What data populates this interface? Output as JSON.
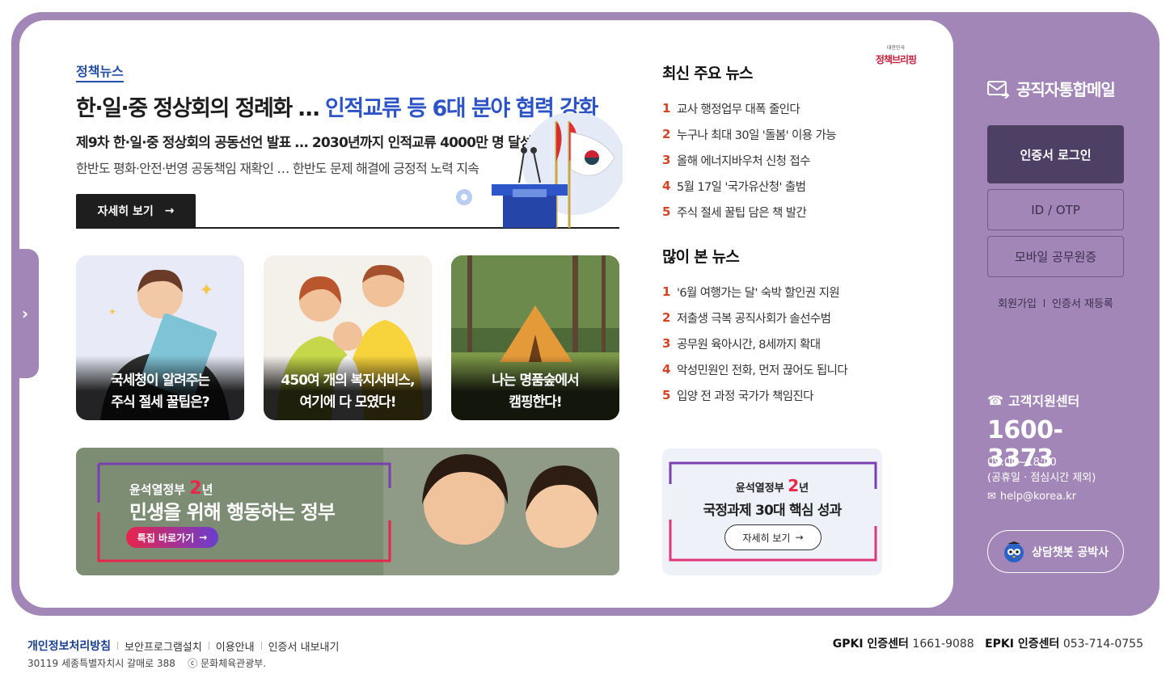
{
  "hero": {
    "tag": "정책뉴스",
    "title_main": "한·일·중 정상회의 정례화 … ",
    "title_highlight": "인적교류 등 6대 분야 협력 강화",
    "subtitle1": "제9차 한·일·중 정상회의 공동선언 발표 … 2030년까지 인적교류 4000만 명 달성",
    "subtitle2": "한반도 평화·안전·번영 공동책임 재확인 … 한반도 문제 해결에 긍정적 노력 지속",
    "more_label": "자세히 보기",
    "more_icon": "→"
  },
  "brand": {
    "small": "대한민국",
    "big": "정책브리핑"
  },
  "cards": [
    {
      "line1": "국세청이 알려주는",
      "line2": "주식 절세 꿀팁은?"
    },
    {
      "line1": "450여 개의 복지서비스,",
      "line2": "여기에 다 모였다!"
    },
    {
      "line1": "나는 명품숲에서",
      "line2": "캠핑한다!"
    }
  ],
  "banner": {
    "line1_prefix": "윤석열정부",
    "line1_num": "2",
    "line1_suffix": "년",
    "line2": "민생을 위해 행동하는 정부",
    "btn_label": "특집 바로가기",
    "btn_icon": "→"
  },
  "latest_news": {
    "heading": "최신 주요 뉴스",
    "items": [
      {
        "num": "1",
        "text": "교사 행정업무 대폭 줄인다"
      },
      {
        "num": "2",
        "text": "누구나 최대 30일 '돌봄' 이용 가능"
      },
      {
        "num": "3",
        "text": "올해 에너지바우처 신청 접수"
      },
      {
        "num": "4",
        "text": "5월 17일 '국가유산청' 출범"
      },
      {
        "num": "5",
        "text": "주식 절세 꿀팁 담은 책 발간"
      }
    ]
  },
  "popular_news": {
    "heading": "많이 본 뉴스",
    "items": [
      {
        "num": "1",
        "text": "'6월 여행가는 달' 숙박 할인권 지원"
      },
      {
        "num": "2",
        "text": "저출생 극복 공직사회가 솔선수범"
      },
      {
        "num": "3",
        "text": "공무원 육아시간, 8세까지 확대"
      },
      {
        "num": "4",
        "text": "악성민원인 전화, 먼저 끊어도 됩니다"
      },
      {
        "num": "5",
        "text": "입양 전 과정 국가가 책임진다"
      }
    ]
  },
  "policy": {
    "line1_prefix": "윤석열정부",
    "line1_num": "2",
    "line1_suffix": "년",
    "line2": "국정과제 30대 핵심 성과",
    "btn_label": "자세히 보기",
    "btn_icon": "→"
  },
  "right": {
    "mail_title": "공직자통합메일",
    "cert_login": "인증서 로그인",
    "id_otp": "ID / OTP",
    "mobile_id": "모바일 공무원증",
    "signup": "회원가입",
    "recert": "인증서 재등록",
    "cs_title": "고객지원센터",
    "phone": "1600-3373",
    "hours1": "09:00~18:00",
    "hours2": "(공휴일 · 점심시간 제외)",
    "email": "help@korea.kr",
    "chatbot": "상담챗봇 공박사"
  },
  "footer": {
    "links": [
      "개인정보처리방침",
      "보안프로그램설치",
      "이용안내",
      "인증서 내보내기"
    ],
    "address": "30119 세종특별자치시 갈매로 388",
    "copyright": "ⓒ 문화체육관광부.",
    "gpki_label": "GPKI 인증센터",
    "gpki_phone": "1661-9088",
    "epki_label": "EPKI 인증센터",
    "epki_phone": "053-714-0755"
  },
  "colors": {
    "frame": "#a286b7",
    "accent_blue": "#2d54c7",
    "rank_red": "#d34324",
    "dark_purple": "#4e3f65"
  }
}
